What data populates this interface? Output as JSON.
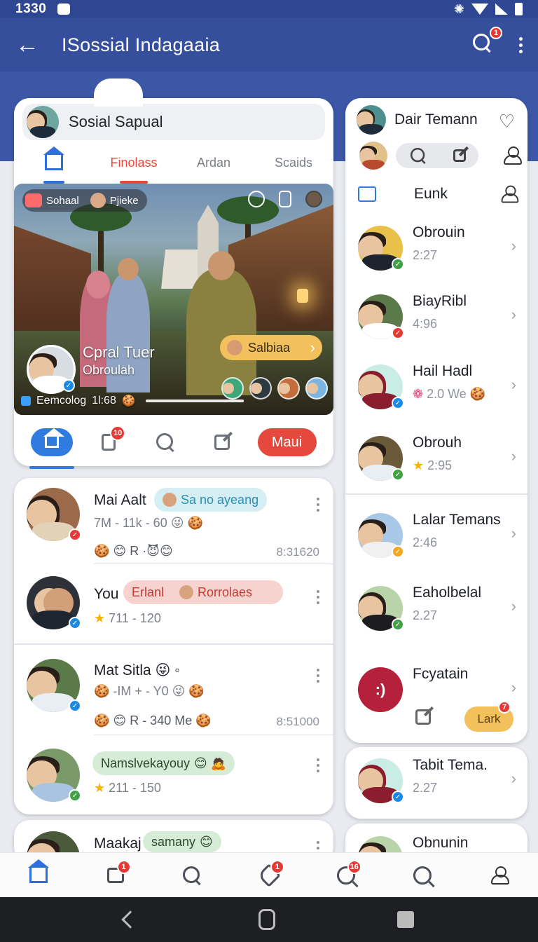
{
  "status": {
    "time": "1330"
  },
  "appbar": {
    "title": "ISossial Indagaaia",
    "search_badge": "1"
  },
  "feature": {
    "header_name": "Sosial Sapual",
    "tabs": [
      {
        "label": "",
        "icon": "home-icon"
      },
      {
        "label": "Finolass"
      },
      {
        "label": "Ardan"
      },
      {
        "label": "Scaids"
      }
    ],
    "hero": {
      "chip_label": "Sohaal",
      "chip_label2": "Pjieke",
      "name": "Cpral Tuer",
      "subtitle": "Obroulah",
      "cta_label": "Salbiaa",
      "footer_label": "Eemcolog",
      "footer_time": "1l:68"
    },
    "actions": {
      "notif_badge": "10",
      "main_button": "Maui"
    }
  },
  "feed": [
    {
      "name": "Mai Aalt",
      "tag": "Sa no ayeang",
      "line2": "7M - 11k - 60",
      "line3": "R",
      "time": "8:31620"
    },
    {
      "name": "You",
      "tag": "Erlanl",
      "tag2": "Rorrolaes",
      "line2": "711 - 120"
    },
    {
      "name": "Mat Sitla",
      "line2": "-IM + - Y0",
      "line3": "R - 340 Me",
      "time": "8:51000"
    },
    {
      "name": "",
      "tag": "Namslvekayouy",
      "line2": "211 - 150"
    },
    {
      "name": "Maakaj",
      "tag": "samany"
    }
  ],
  "right_panel": {
    "title": "Dair Temann",
    "sub_title": "Eunk",
    "contacts": [
      {
        "name": "Obrouin",
        "time": "2:27"
      },
      {
        "name": "BiayRibl",
        "time": "4:96"
      },
      {
        "name": "Hail Hadl",
        "time": "2.0 We"
      },
      {
        "name": "Obrouh",
        "time": "2:95"
      },
      {
        "name": "Lalar Temans",
        "time": "2:46"
      },
      {
        "name": "Eaholbelal",
        "time": "2.27"
      },
      {
        "name": "Fcyatain",
        "time": ""
      }
    ],
    "lark_label": "Lark",
    "lark_badge": "7"
  },
  "right_card2": {
    "name": "Tabit Tema.",
    "time": "2.27"
  },
  "right_card3": {
    "name": "Obnunin"
  },
  "bottom_nav": {
    "badges": [
      "",
      "1",
      "",
      "1",
      "16",
      "",
      ""
    ]
  }
}
